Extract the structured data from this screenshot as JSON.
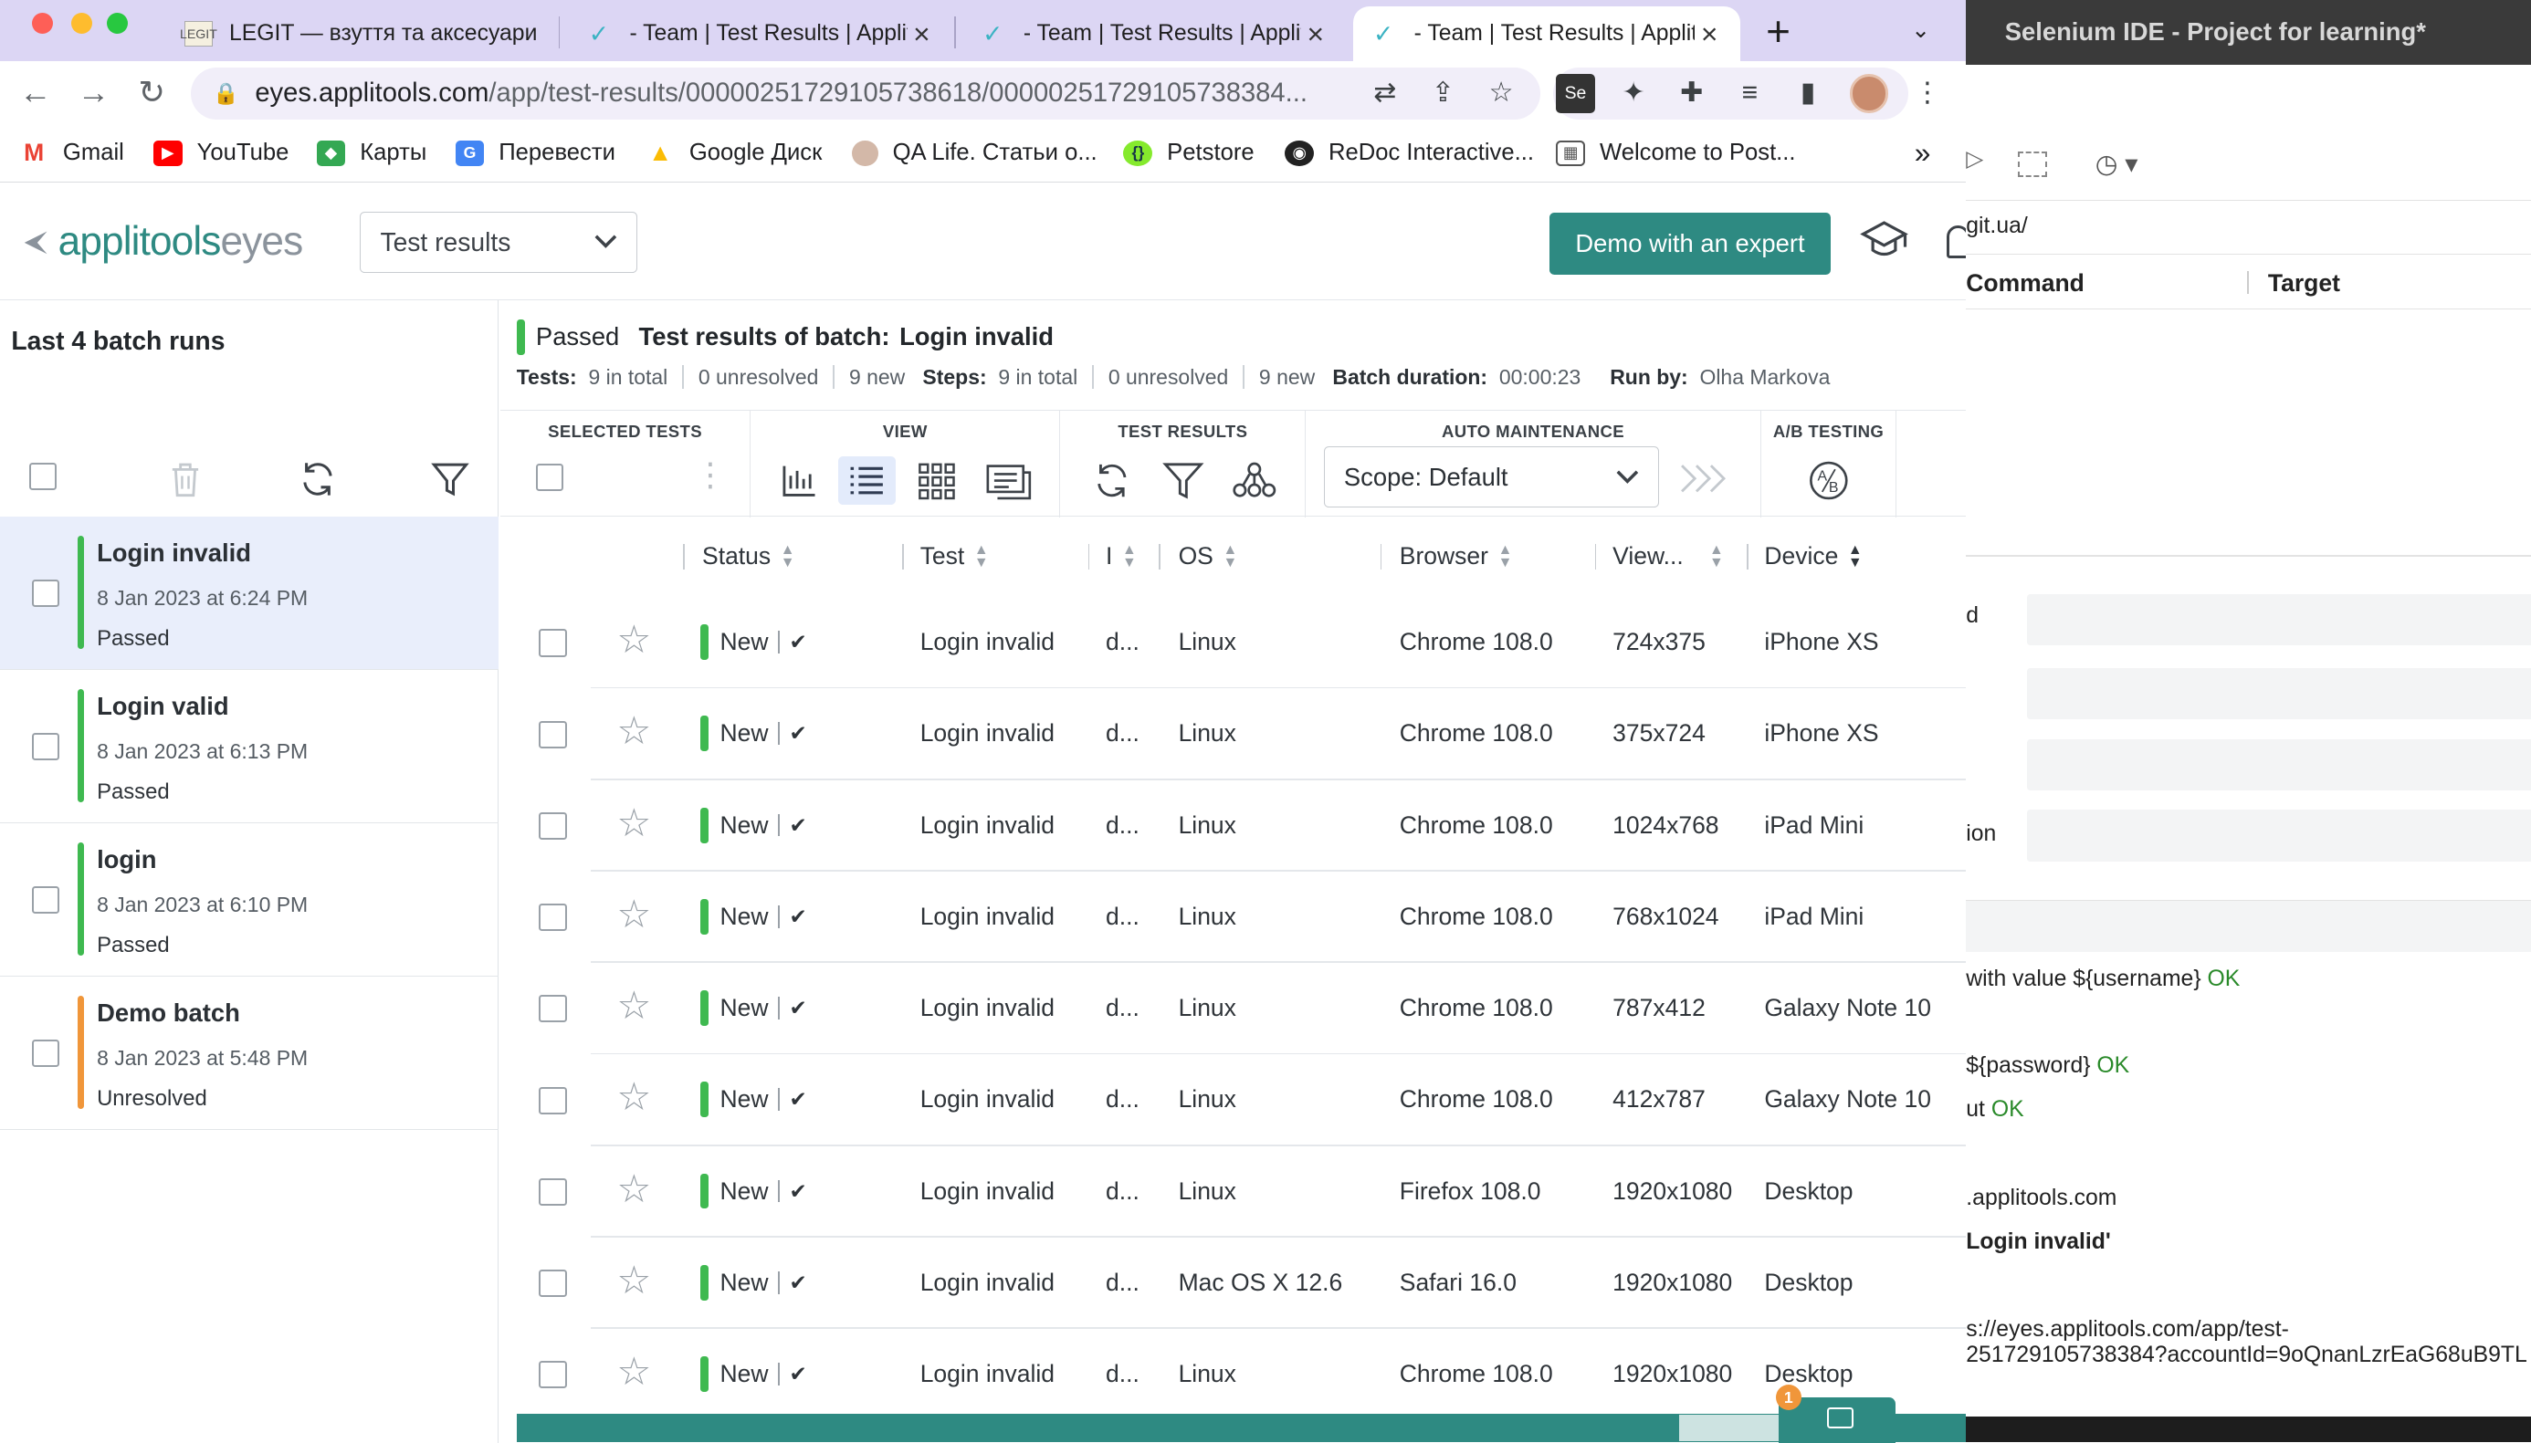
{
  "browser": {
    "tabs": [
      {
        "title": "LEGIT — взуття та аксесуари",
        "favicon": "legit-favicon"
      },
      {
        "title": "- Team | Test Results | Applitools",
        "favicon": "applitools-favicon"
      },
      {
        "title": "- Team | Test Results | Applitools",
        "favicon": "applitools-favicon"
      },
      {
        "title": "- Team | Test Results | Applitools",
        "favicon": "applitools-favicon"
      }
    ],
    "url_host": "eyes.applitools.com",
    "url_path": "/app/test-results/00000251729105738618/00000251729105738384...",
    "bookmarks": [
      "Gmail",
      "YouTube",
      "Карты",
      "Перевести",
      "Google Диск",
      "QA Life. Статьи о...",
      "Petstore",
      "ReDoc Interactive...",
      "Welcome to Post..."
    ],
    "more_bookmarks": "»"
  },
  "app": {
    "logo_main": "applitools",
    "logo_sub": "eyes",
    "view_select": "Test results",
    "demo_button": "Demo with an expert"
  },
  "left": {
    "title": "Last 4 batch runs",
    "batches": [
      {
        "name": "Login invalid",
        "date": "8 Jan 2023 at 6:24 PM",
        "status": "Passed",
        "color": "#3fb950"
      },
      {
        "name": "Login valid",
        "date": "8 Jan 2023 at 6:13 PM",
        "status": "Passed",
        "color": "#3fb950"
      },
      {
        "name": "login",
        "date": "8 Jan 2023 at 6:10 PM",
        "status": "Passed",
        "color": "#3fb950"
      },
      {
        "name": "Demo batch",
        "date": "8 Jan 2023 at 5:48 PM",
        "status": "Unresolved",
        "color": "#f0963a"
      }
    ]
  },
  "summary": {
    "status": "Passed",
    "heading": "Test results of batch:",
    "batch": "Login invalid",
    "tests_label": "Tests:",
    "tests_total": "9 in total",
    "tests_unresolved": "0 unresolved",
    "tests_new": "9 new",
    "steps_label": "Steps:",
    "steps_total": "9 in total",
    "steps_unresolved": "0 unresolved",
    "steps_new": "9 new",
    "duration_label": "Batch duration:",
    "duration": "00:00:23",
    "runby_label": "Run by:",
    "runby": "Olha Markova"
  },
  "ribbon": {
    "selected_tests": "SELECTED TESTS",
    "view": "VIEW",
    "test_results": "TEST RESULTS",
    "auto_maintenance": "AUTO MAINTENANCE",
    "ab_testing": "A/B TESTING",
    "scope": "Scope: Default"
  },
  "table": {
    "columns": [
      "Status",
      "Test",
      "I",
      "OS",
      "Browser",
      "View...",
      "Device"
    ],
    "rows": [
      {
        "status": "New",
        "test": "Login invalid",
        "i": "d...",
        "os": "Linux",
        "browser": "Chrome 108.0",
        "viewport": "724x375",
        "device": "iPhone XS"
      },
      {
        "status": "New",
        "test": "Login invalid",
        "i": "d...",
        "os": "Linux",
        "browser": "Chrome 108.0",
        "viewport": "375x724",
        "device": "iPhone XS"
      },
      {
        "status": "New",
        "test": "Login invalid",
        "i": "d...",
        "os": "Linux",
        "browser": "Chrome 108.0",
        "viewport": "1024x768",
        "device": "iPad Mini"
      },
      {
        "status": "New",
        "test": "Login invalid",
        "i": "d...",
        "os": "Linux",
        "browser": "Chrome 108.0",
        "viewport": "768x1024",
        "device": "iPad Mini"
      },
      {
        "status": "New",
        "test": "Login invalid",
        "i": "d...",
        "os": "Linux",
        "browser": "Chrome 108.0",
        "viewport": "787x412",
        "device": "Galaxy Note 10"
      },
      {
        "status": "New",
        "test": "Login invalid",
        "i": "d...",
        "os": "Linux",
        "browser": "Chrome 108.0",
        "viewport": "412x787",
        "device": "Galaxy Note 10"
      },
      {
        "status": "New",
        "test": "Login invalid",
        "i": "d...",
        "os": "Linux",
        "browser": "Firefox 108.0",
        "viewport": "1920x1080",
        "device": "Desktop"
      },
      {
        "status": "New",
        "test": "Login invalid",
        "i": "d...",
        "os": "Mac OS X 12.6",
        "browser": "Safari 16.0",
        "viewport": "1920x1080",
        "device": "Desktop"
      },
      {
        "status": "New",
        "test": "Login invalid",
        "i": "d...",
        "os": "Linux",
        "browser": "Chrome 108.0",
        "viewport": "1920x1080",
        "device": "Desktop"
      }
    ],
    "chat_badge": "1"
  },
  "ide": {
    "title": "Selenium IDE - Project for learning*",
    "url_fragment": "git.ua/",
    "col_command": "Command",
    "col_target": "Target",
    "field_labels": [
      "d",
      "ion"
    ],
    "log": [
      {
        "text": "with value ${username}",
        "ok": "OK"
      },
      {
        "text": "${password}",
        "ok": "OK"
      },
      {
        "text": "ut",
        "ok": "OK"
      },
      {
        "text": ".applitools.com",
        "ok": ""
      },
      {
        "text": "Login invalid'",
        "ok": ""
      },
      {
        "text": "s://eyes.applitools.com/app/test-",
        "ok": ""
      },
      {
        "text": "251729105738384?accountId=9oQnanLzrEaG68uB9TL",
        "ok": ""
      }
    ]
  }
}
